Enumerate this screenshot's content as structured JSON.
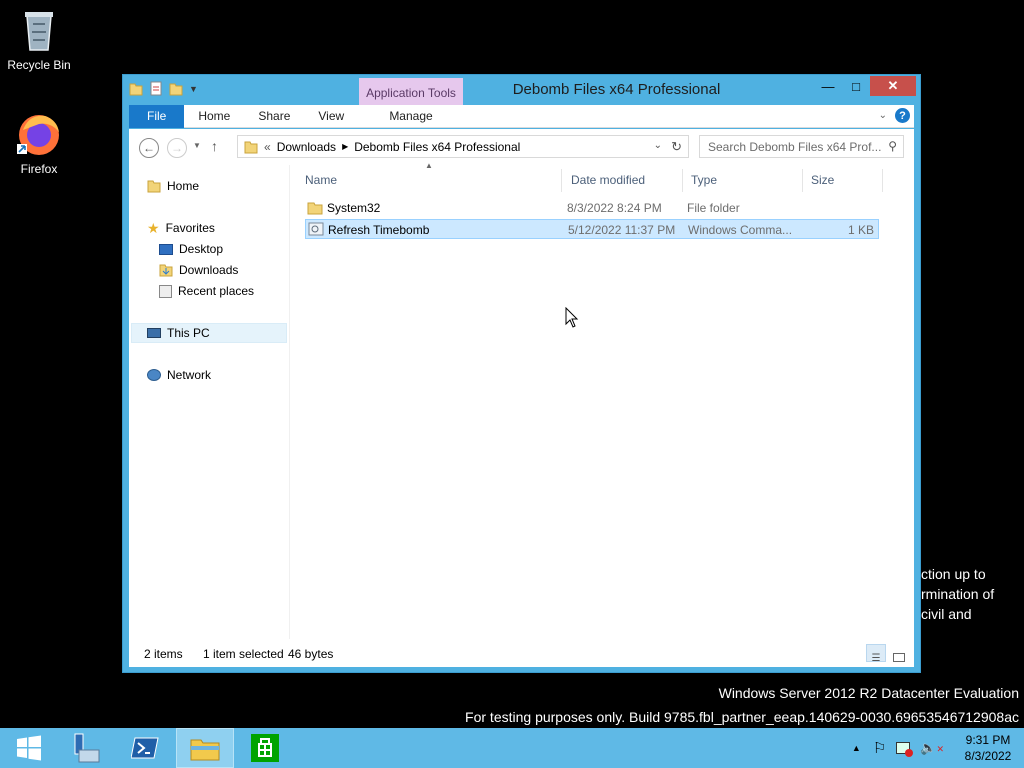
{
  "desktop": {
    "icons": [
      {
        "label": "Recycle Bin"
      },
      {
        "label": "Firefox"
      }
    ],
    "notice_lines": [
      "ction up to",
      "rmination of",
      "civil and"
    ],
    "watermark": {
      "line1": "Windows Server 2012 R2 Datacenter Evaluation",
      "line2": "For testing purposes only. Build 9785.fbl_partner_eeap.140629-0030.69653546712908ac"
    }
  },
  "window": {
    "title": "Debomb Files x64 Professional",
    "context_tab": "Application Tools",
    "ribbon_tabs": [
      "File",
      "Home",
      "Share",
      "View",
      "Manage"
    ],
    "address": {
      "prefix": "«",
      "crumbs": [
        "Downloads",
        "Debomb Files x64 Professional"
      ]
    },
    "search_placeholder": "Search Debomb Files x64 Prof...",
    "nav": {
      "home": "Home",
      "favorites": "Favorites",
      "desktop": "Desktop",
      "downloads": "Downloads",
      "recent": "Recent places",
      "thispc": "This PC",
      "network": "Network"
    },
    "columns": [
      "Name",
      "Date modified",
      "Type",
      "Size"
    ],
    "files": [
      {
        "name": "System32",
        "date": "8/3/2022 8:24 PM",
        "type": "File folder",
        "size": ""
      },
      {
        "name": "Refresh Timebomb",
        "date": "5/12/2022 11:37 PM",
        "type": "Windows Comma...",
        "size": "1 KB"
      }
    ],
    "status": {
      "items": "2 items",
      "selected": "1 item selected",
      "bytes": "46 bytes"
    }
  },
  "taskbar": {
    "time": "9:31 PM",
    "date": "8/3/2022"
  },
  "colors": {
    "window_frame": "#4fb1e1",
    "taskbar": "#5fb9e6",
    "file_tab": "#1979ca",
    "selection": "#cce8ff",
    "close_button": "#c7504b"
  }
}
